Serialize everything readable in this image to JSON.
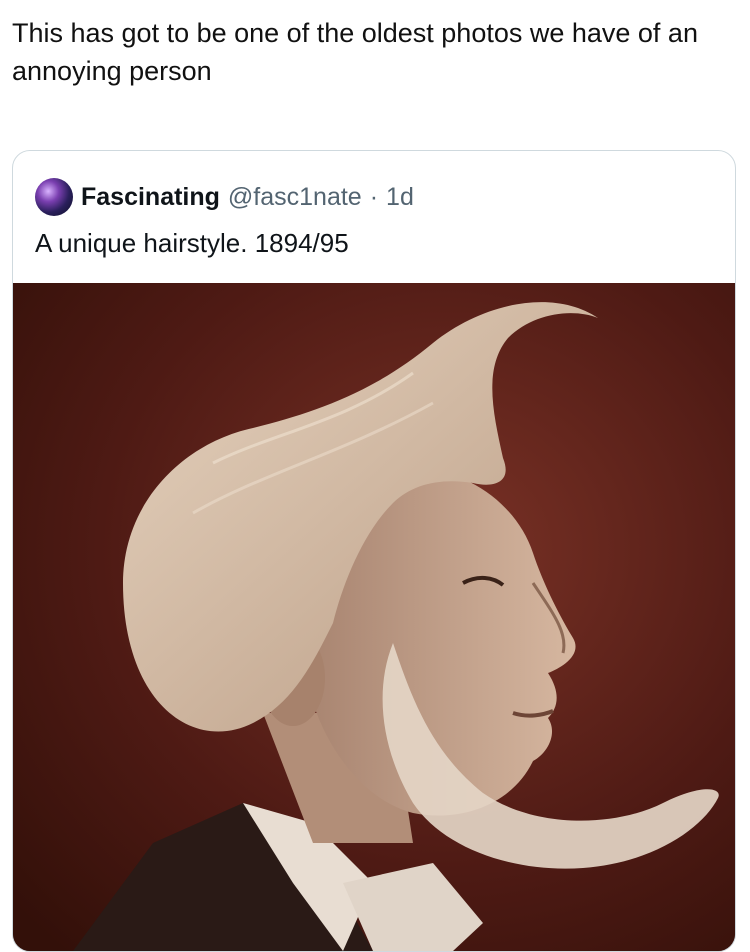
{
  "post": {
    "text": "This has got to be one of the oldest photos we have of an annoying person"
  },
  "quoted_tweet": {
    "display_name": "Fascinating",
    "handle": "@fasc1nate",
    "separator": "·",
    "age": "1d",
    "text": "A unique hairstyle. 1894/95",
    "photo_subject": "sepia portrait of a man in profile with swept-up hair and mutton-chop beard"
  },
  "colors": {
    "photo_background": "#4e1a14",
    "hair": "#d9c3ad",
    "skin": "#c9a790",
    "handle_gray": "#536471"
  }
}
